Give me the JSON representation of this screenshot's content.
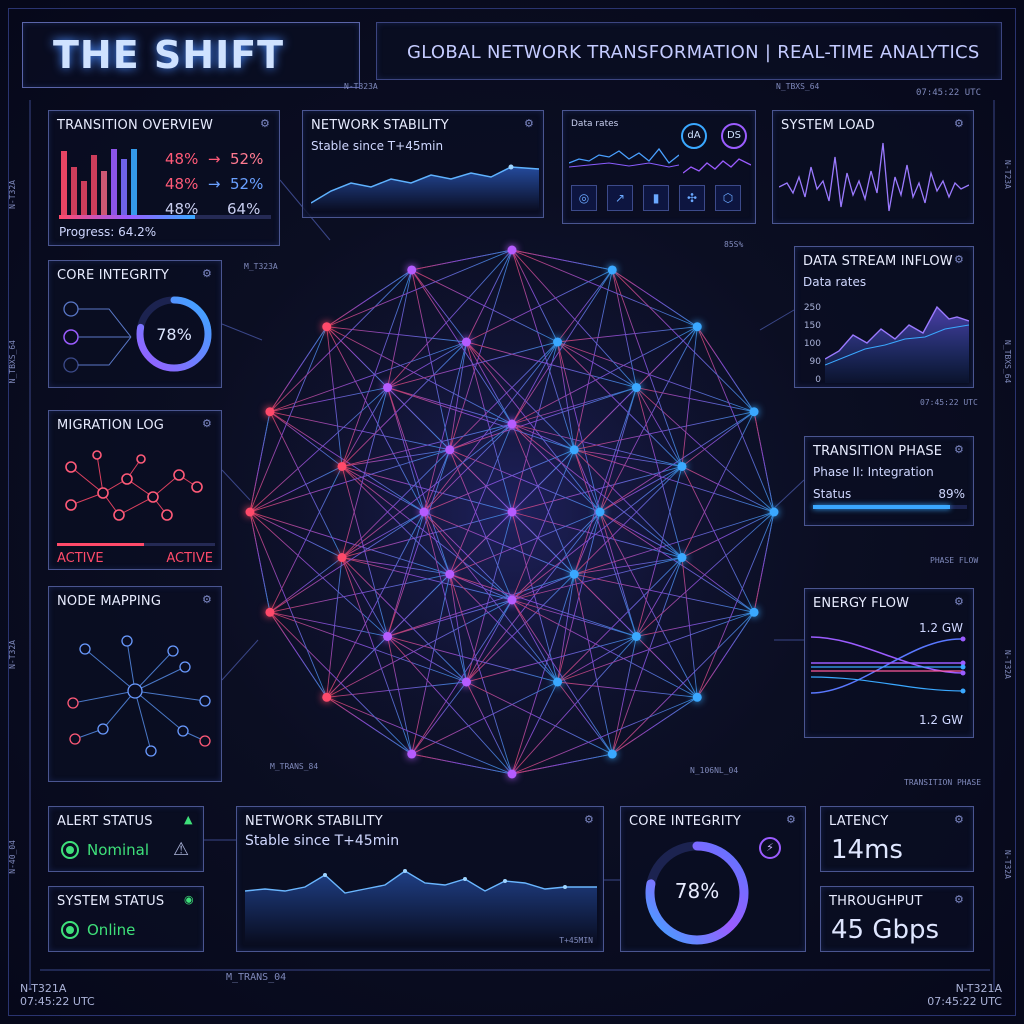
{
  "header": {
    "title": "THE SHIFT",
    "subtitle": "GLOBAL NETWORK TRANSFORMATION | REAL-TIME ANALYTICS",
    "code_left": "N-T323A",
    "code_right": "N_TBXS_64",
    "time": "07:45:22 UTC"
  },
  "side_labels": {
    "left": [
      "N-T32A",
      "N_TBXS_64",
      "N-T32A",
      "N-40_04"
    ],
    "right": [
      "N-T23A",
      "N_TBXS_64",
      "N-T32A",
      "N-T32A"
    ]
  },
  "transition_overview": {
    "title": "TRANSITION OVERVIEW",
    "rows": [
      {
        "from": "48%",
        "to": "52%",
        "color": "#ff4a6a"
      },
      {
        "from": "48%",
        "to": "52%",
        "color": "#ff4a6a"
      },
      {
        "from": "48%",
        "to": "64%",
        "color": "#aab2d8"
      }
    ],
    "progress_label": "Progress: 64.2%",
    "progress": 64.2
  },
  "network_stability_top": {
    "title": "NETWORK STABILITY",
    "subtitle": "Stable since T+45min"
  },
  "data_rates_panel": {
    "label": "Data rates",
    "badges": [
      "dA",
      "DS"
    ]
  },
  "system_load": {
    "title": "SYSTEM LOAD"
  },
  "core_integrity_left": {
    "title": "CORE INTEGRITY",
    "tag": "M_T323A",
    "value": "78%",
    "percent": 78
  },
  "migration_log": {
    "title": "MIGRATION LOG",
    "status_left": "ACTIVE",
    "status_right": "ACTIVE"
  },
  "node_mapping": {
    "title": "NODE MAPPING",
    "tag": "M_TRANS_84"
  },
  "data_stream_inflow": {
    "title": "DATA STREAM INFLOW",
    "subtitle": "Data rates",
    "yticks": [
      "250",
      "150",
      "100",
      "90",
      "0"
    ],
    "tag": "85S%",
    "time": "07:45:22 UTC"
  },
  "transition_phase": {
    "title": "TRANSITION PHASE",
    "phase": "Phase II: Integration",
    "status_label": "Status",
    "status_value": "89%",
    "percent": 89,
    "flow_tag": "PHASE FLOW"
  },
  "energy_flow": {
    "title": "ENERGY FLOW",
    "top_value": "1.2 GW",
    "bottom_value": "1.2 GW",
    "footer_tag": "TRANSITION PHASE",
    "mid_tag": "N_106NL_04"
  },
  "alert_status": {
    "title": "ALERT STATUS",
    "value": "Nominal"
  },
  "system_status": {
    "title": "SYSTEM STATUS",
    "value": "Online"
  },
  "network_stability_bottom": {
    "title": "NETWORK STABILITY",
    "subtitle": "Stable since T+45min",
    "tag": "T+45MIN"
  },
  "core_integrity_bottom": {
    "title": "CORE INTEGRITY",
    "value": "78%",
    "percent": 78
  },
  "latency": {
    "title": "LATENCY",
    "value": "14ms"
  },
  "throughput": {
    "title": "THROUGHPUT",
    "value": "45 Gbps"
  },
  "footer": {
    "code_left": "N-T321A",
    "time_left": "07:45:22 UTC",
    "center_tag": "M_TRANS_04",
    "code_right": "N-T321A",
    "time_right": "07:45:22 UTC"
  },
  "colors": {
    "accent_blue": "#3aa8ff",
    "accent_purple": "#9b5cff",
    "accent_red": "#ff4a6a",
    "status_green": "#3ee07a"
  }
}
